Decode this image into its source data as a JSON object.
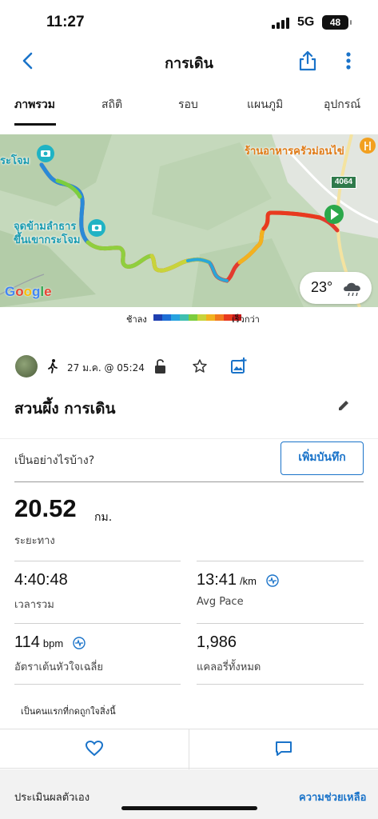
{
  "status": {
    "time": "11:27",
    "network": "5G",
    "battery": "48"
  },
  "nav": {
    "title": "การเดิน"
  },
  "tabs": [
    {
      "label": "ภาพรวม",
      "active": true
    },
    {
      "label": "สถิติ"
    },
    {
      "label": "รอบ"
    },
    {
      "label": "แผนภูมิ"
    },
    {
      "label": "อุปกรณ์"
    }
  ],
  "map": {
    "label_start": "ระโจม",
    "label_crossing_line1": "จุดข้ามลำธาร",
    "label_crossing_line2": "ขึ้นเขากระโจม",
    "label_restaurant": "ร้านอาหารครัวม่อนไข่",
    "road_number": "4064",
    "google": "Google",
    "weather_temp": "23°"
  },
  "legend": {
    "slow": "ช้าลง",
    "fast": "เร็วกว่า",
    "colors": [
      "#1f3fb0",
      "#1e6fd6",
      "#27a3e0",
      "#3fbfb0",
      "#7ccd3e",
      "#c8d43a",
      "#f2b21f",
      "#f27a1f",
      "#e83a1f",
      "#c41a1a"
    ]
  },
  "meta": {
    "date": "27 ม.ค. @ 05:24"
  },
  "activity": {
    "title": "สวนผึ้ง การเดิน"
  },
  "feel": {
    "prompt": "เป็นอย่างไรบ้าง?",
    "button": "เพิ่มบันทึก"
  },
  "stats": {
    "distance": {
      "value": "20.52",
      "unit": "กม.",
      "label": "ระยะทาง"
    },
    "total_time": {
      "value": "4:40:48",
      "label": "เวลารวม"
    },
    "avg_pace": {
      "value": "13:41",
      "unit": "/km",
      "label": "Avg Pace"
    },
    "avg_hr": {
      "value": "114",
      "unit": "bpm",
      "label": "อัตราเต้นหัวใจเฉลี่ย"
    },
    "calories": {
      "value": "1,986",
      "label": "แคลอรี่ทั้งหมด"
    }
  },
  "social": {
    "first_like": "เป็นคนแรกที่กดถูกใจสิ่งนี้"
  },
  "footer": {
    "left": "ประเมินผลตัวเอง",
    "right": "ความช่วยเหลือ"
  }
}
